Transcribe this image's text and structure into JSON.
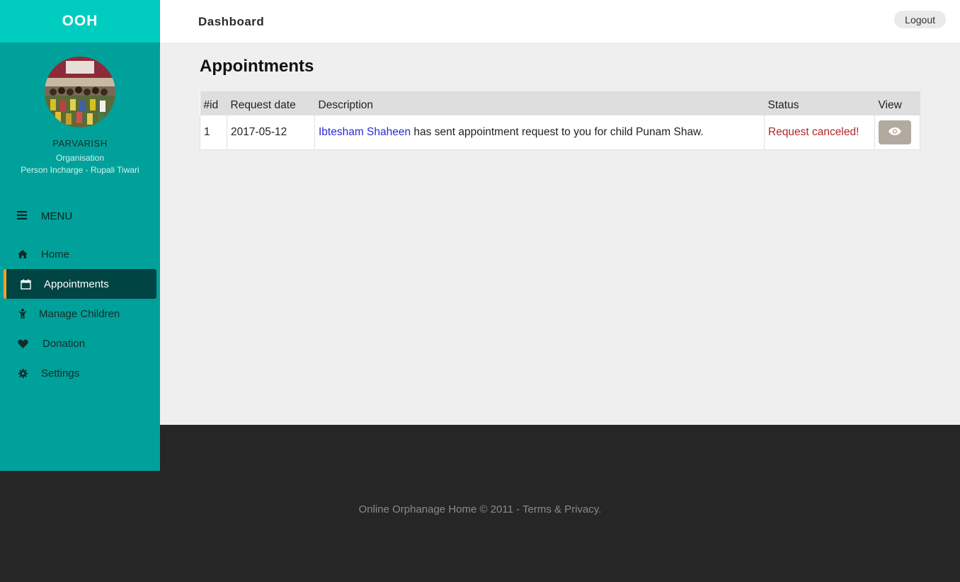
{
  "brand": "OOH",
  "org": {
    "name": "PARVARISH",
    "type": "Organisation",
    "incharge": "Person Incharge - Rupali Tiwari"
  },
  "menu_label": "MENU",
  "nav": [
    {
      "label": "Home",
      "icon": "home-icon"
    },
    {
      "label": "Appointments",
      "icon": "calendar-icon",
      "active": true
    },
    {
      "label": "Manage Children",
      "icon": "child-icon"
    },
    {
      "label": "Donation",
      "icon": "heart-icon"
    },
    {
      "label": "Settings",
      "icon": "gear-icon"
    }
  ],
  "topbar": {
    "title": "Dashboard",
    "logout_label": "Logout"
  },
  "page": {
    "title": "Appointments"
  },
  "table": {
    "headers": [
      "#id",
      "Request date",
      "Description",
      "Status",
      "View"
    ],
    "rows": [
      {
        "id": "1",
        "date": "2017-05-12",
        "requester": "Ibtesham Shaheen",
        "description_rest": " has sent appointment request to you for child Punam Shaw.",
        "status": "Request canceled!"
      }
    ]
  },
  "footer": {
    "text": "Online Orphanage Home © 2011 - Terms & Privacy."
  },
  "colors": {
    "sidebar": "#00a19a",
    "brand_bar": "#00cdbf",
    "active_nav": "#004443",
    "active_accent": "#f0a030",
    "footer": "#262626",
    "status_canceled": "#b0262a"
  }
}
